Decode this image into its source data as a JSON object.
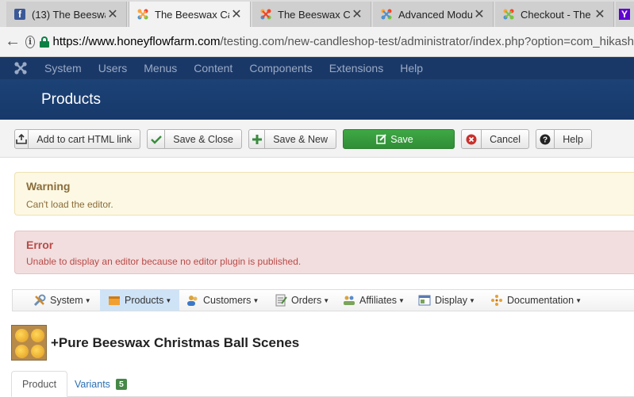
{
  "browser": {
    "tabs": [
      {
        "title": "(13) The Beeswa",
        "favicon": "facebook-icon",
        "active": false
      },
      {
        "title": "The Beeswax Ca",
        "favicon": "joomla-icon",
        "active": true
      },
      {
        "title": "The Beeswax Ca",
        "favicon": "joomla-icon",
        "active": false
      },
      {
        "title": "Advanced Modu",
        "favicon": "joomla-icon",
        "active": false
      },
      {
        "title": "Checkout - The",
        "favicon": "joomla-icon",
        "active": false
      },
      {
        "title": "Y",
        "favicon": "yahoo-icon",
        "active": false
      }
    ],
    "close_glyph": "✕",
    "url_host": "https://www.honeyflowfarm.com",
    "url_path": "/testing.com/new-candleshop-test/administrator/index.php?option=com_hikash"
  },
  "admin_menu": {
    "items": [
      "System",
      "Users",
      "Menus",
      "Content",
      "Components",
      "Extensions",
      "Help"
    ]
  },
  "page_title": "Products",
  "toolbar": {
    "add_to_cart_label": "Add to cart HTML link",
    "save_close_label": "Save & Close",
    "save_new_label": "Save & New",
    "save_label": "Save",
    "cancel_label": "Cancel",
    "help_label": "Help"
  },
  "alerts": {
    "warning": {
      "title": "Warning",
      "message": "Can't load the editor."
    },
    "error": {
      "title": "Error",
      "message": "Unable to display an editor because no editor plugin is published."
    }
  },
  "hika_menu": {
    "items": [
      {
        "label": "System",
        "icon": "tools-icon"
      },
      {
        "label": "Products",
        "icon": "products-box-icon",
        "active": true
      },
      {
        "label": "Customers",
        "icon": "customers-icon"
      },
      {
        "label": "Orders",
        "icon": "orders-icon"
      },
      {
        "label": "Affiliates",
        "icon": "affiliates-icon"
      },
      {
        "label": "Display",
        "icon": "display-icon"
      },
      {
        "label": "Documentation",
        "icon": "documentation-icon"
      }
    ]
  },
  "product": {
    "title": "+Pure Beeswax Christmas Ball Scenes"
  },
  "product_tabs": {
    "product_label": "Product",
    "variants_label": "Variants",
    "variants_count": "5"
  },
  "colors": {
    "admin_nav_bg": "#1a3867",
    "header_bg": "#1c4276",
    "save_green": "#3fa845",
    "warning_bg": "#fcf8e3",
    "error_bg": "#f2dede",
    "link_blue": "#2a6fb5"
  }
}
